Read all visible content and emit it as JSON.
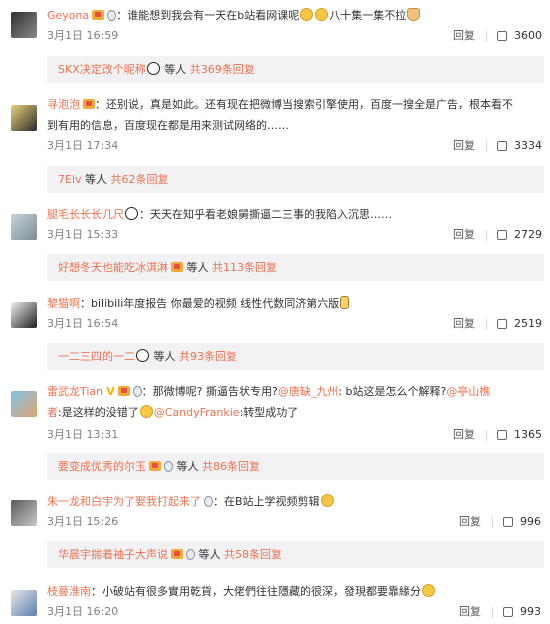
{
  "comments": [
    {
      "user": "Geyona",
      "text_a": "谁能想到我会有一天在b站看网课呢",
      "text_b": "八十集一集不拉",
      "date": "3月1日 16:59",
      "reply_label": "回复",
      "likes": "3600",
      "sub_user": "SKX决定改个昵称",
      "sub_mid": "等人",
      "sub_more": "共369条回复"
    },
    {
      "user": "寻泡泡",
      "text_a": "还别说，真是如此。还有现在把微博当搜索引擎使用，百度一搜全是广告，根本看不",
      "text_b": "到有用的信息，百度现在都是用来测试网络的……",
      "date": "3月1日 17:34",
      "reply_label": "回复",
      "likes": "3334",
      "sub_user": "7Elv",
      "sub_mid": "等人",
      "sub_more": "共62条回复"
    },
    {
      "user": "腿毛长长长几尺",
      "text_a": "天天在知乎看老娘舅撕逼二三事的我陷入沉思……",
      "date": "3月1日 15:33",
      "reply_label": "回复",
      "likes": "2729",
      "sub_user": "好想冬天也能吃冰淇淋",
      "sub_mid": "等人",
      "sub_more": "共113条回复"
    },
    {
      "user": "黎猫啊",
      "text_a": "bilibili年度报告 你最爱的视频 线性代数同济第六版",
      "date": "3月1日 16:54",
      "reply_label": "回复",
      "likes": "2519",
      "sub_user": "一二三四的一二",
      "sub_mid": "等人",
      "sub_more": "共93条回复"
    },
    {
      "user": "雷武龙Tian",
      "text_a": "那微博呢? 撕逼告状专用?",
      "mention_1": "@唐缺_九州",
      "text_c": ": b站这是怎么个解释?",
      "mention_2": "@亭山樵",
      "mention_2b": "者",
      "text_d": ":是这样的没错了",
      "mention_3": "@CandyFrankie",
      "text_e": ":转型成功了",
      "date": "3月1日 13:31",
      "reply_label": "回复",
      "likes": "1365",
      "sub_user": "要变成优秀的尔玉",
      "sub_mid": "等人",
      "sub_more": "共86条回复"
    },
    {
      "user": "朱一龙和白宇为了娶我打起来了",
      "text_a": "在B站上学视频剪辑",
      "date": "3月1日 15:26",
      "reply_label": "回复",
      "likes": "996",
      "sub_user": "华晨宇揣着袖子大声说",
      "sub_mid": "等人",
      "sub_more": "共58条回复"
    },
    {
      "user": "枝蔓淮南",
      "text_a": "小破站有很多實用乾貨，大佬們往往隱藏的很深，發現都要靠緣分",
      "date": "3月1日 16:20",
      "reply_label": "回复",
      "likes": "993"
    }
  ],
  "icons": {
    "thumb": "thumbs-up-icon",
    "badge": "member-badge-icon",
    "medal": "medal-icon",
    "emoji": "emoji-icon"
  },
  "colors": {
    "username": "#eb7350",
    "reply_bg": "#f2f2f5",
    "meta": "#808080"
  }
}
